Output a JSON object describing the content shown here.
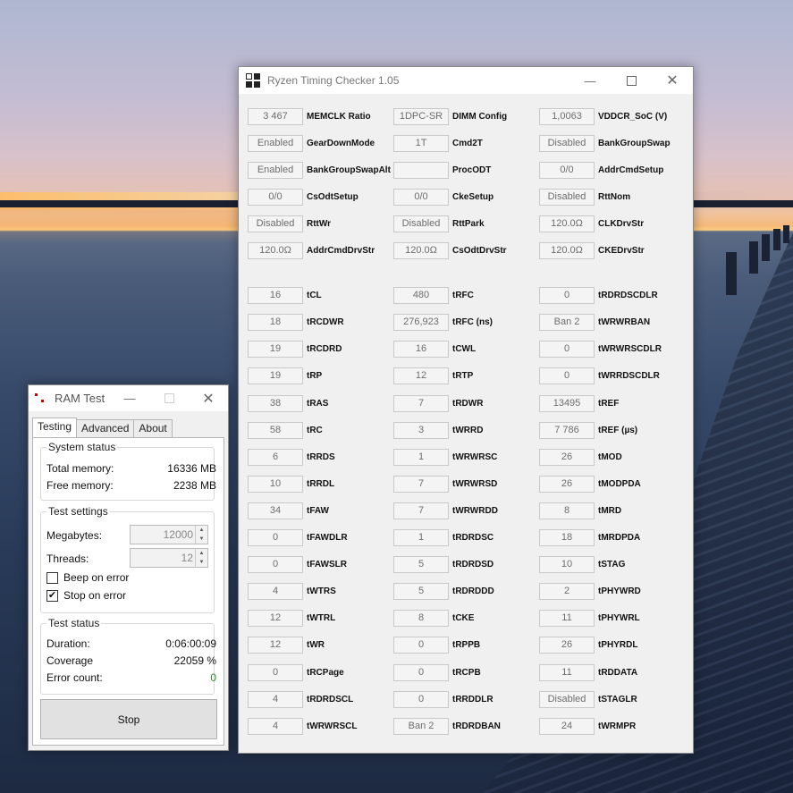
{
  "rtc": {
    "title": "Ryzen Timing Checker 1.05",
    "columns": [
      [
        {
          "value": "3 467",
          "label": "MEMCLK Ratio"
        },
        {
          "value": "Enabled",
          "label": "GearDownMode"
        },
        {
          "value": "Enabled",
          "label": "BankGroupSwapAlt"
        },
        {
          "value": "0/0",
          "label": "CsOdtSetup"
        },
        {
          "value": "Disabled",
          "label": "RttWr"
        },
        {
          "value": "120.0Ω",
          "label": "AddrCmdDrvStr"
        },
        {
          "value": "16",
          "label": "tCL"
        },
        {
          "value": "18",
          "label": "tRCDWR"
        },
        {
          "value": "19",
          "label": "tRCDRD"
        },
        {
          "value": "19",
          "label": "tRP"
        },
        {
          "value": "38",
          "label": "tRAS"
        },
        {
          "value": "58",
          "label": "tRC"
        },
        {
          "value": "6",
          "label": "tRRDS"
        },
        {
          "value": "10",
          "label": "tRRDL"
        },
        {
          "value": "34",
          "label": "tFAW"
        },
        {
          "value": "0",
          "label": "tFAWDLR"
        },
        {
          "value": "0",
          "label": "tFAWSLR"
        },
        {
          "value": "4",
          "label": "tWTRS"
        },
        {
          "value": "12",
          "label": "tWTRL"
        },
        {
          "value": "12",
          "label": "tWR"
        },
        {
          "value": "0",
          "label": "tRCPage"
        },
        {
          "value": "4",
          "label": "tRDRDSCL"
        },
        {
          "value": "4",
          "label": "tWRWRSCL"
        }
      ],
      [
        {
          "value": "1DPC-SR",
          "label": "DIMM Config"
        },
        {
          "value": "1T",
          "label": "Cmd2T"
        },
        {
          "value": "",
          "label": "ProcODT"
        },
        {
          "value": "0/0",
          "label": "CkeSetup"
        },
        {
          "value": "Disabled",
          "label": "RttPark"
        },
        {
          "value": "120.0Ω",
          "label": "CsOdtDrvStr"
        },
        {
          "value": "480",
          "label": "tRFC"
        },
        {
          "value": "276,923",
          "label": "tRFC (ns)"
        },
        {
          "value": "16",
          "label": "tCWL"
        },
        {
          "value": "12",
          "label": "tRTP"
        },
        {
          "value": "7",
          "label": "tRDWR"
        },
        {
          "value": "3",
          "label": "tWRRD"
        },
        {
          "value": "1",
          "label": "tWRWRSC"
        },
        {
          "value": "7",
          "label": "tWRWRSD"
        },
        {
          "value": "7",
          "label": "tWRWRDD"
        },
        {
          "value": "1",
          "label": "tRDRDSC"
        },
        {
          "value": "5",
          "label": "tRDRDSD"
        },
        {
          "value": "5",
          "label": "tRDRDDD"
        },
        {
          "value": "8",
          "label": "tCKE"
        },
        {
          "value": "0",
          "label": "tRPPB"
        },
        {
          "value": "0",
          "label": "tRCPB"
        },
        {
          "value": "0",
          "label": "tRRDDLR"
        },
        {
          "value": "Ban 2",
          "label": "tRDRDBAN"
        }
      ],
      [
        {
          "value": "1,0063",
          "label": "VDDCR_SoC (V)"
        },
        {
          "value": "Disabled",
          "label": "BankGroupSwap"
        },
        {
          "value": "0/0",
          "label": "AddrCmdSetup"
        },
        {
          "value": "Disabled",
          "label": "RttNom"
        },
        {
          "value": "120.0Ω",
          "label": "CLKDrvStr"
        },
        {
          "value": "120.0Ω",
          "label": "CKEDrvStr"
        },
        {
          "value": "0",
          "label": "tRDRDSCDLR"
        },
        {
          "value": "Ban 2",
          "label": "tWRWRBAN"
        },
        {
          "value": "0",
          "label": "tWRWRSCDLR"
        },
        {
          "value": "0",
          "label": "tWRRDSCDLR"
        },
        {
          "value": "13495",
          "label": "tREF"
        },
        {
          "value": "7 786",
          "label": "tREF (µs)"
        },
        {
          "value": "26",
          "label": "tMOD"
        },
        {
          "value": "26",
          "label": "tMODPDA"
        },
        {
          "value": "8",
          "label": "tMRD"
        },
        {
          "value": "18",
          "label": "tMRDPDA"
        },
        {
          "value": "10",
          "label": "tSTAG"
        },
        {
          "value": "2",
          "label": "tPHYWRD"
        },
        {
          "value": "11",
          "label": "tPHYWRL"
        },
        {
          "value": "26",
          "label": "tPHYRDL"
        },
        {
          "value": "11",
          "label": "tRDDATA"
        },
        {
          "value": "Disabled",
          "label": "tSTAGLR"
        },
        {
          "value": "24",
          "label": "tWRMPR"
        }
      ]
    ]
  },
  "ram": {
    "title": "RAM Test",
    "tabs": [
      "Testing",
      "Advanced",
      "About"
    ],
    "system_status": {
      "title": "System status",
      "total_label": "Total memory:",
      "total_value": "16336 MB",
      "free_label": "Free memory:",
      "free_value": "2238 MB"
    },
    "test_settings": {
      "title": "Test settings",
      "megabytes_label": "Megabytes:",
      "megabytes_value": "12000",
      "threads_label": "Threads:",
      "threads_value": "12",
      "beep_label": "Beep on error",
      "beep_checked": false,
      "stop_label": "Stop on error",
      "stop_checked": true
    },
    "test_status": {
      "title": "Test status",
      "duration_label": "Duration:",
      "duration_value": "0:06:00:09",
      "coverage_label": "Coverage",
      "coverage_value": "22059 %",
      "errors_label": "Error count:",
      "errors_value": "0"
    },
    "stop_button": "Stop"
  },
  "colors": {
    "error_ok": "#2e8b2e"
  }
}
